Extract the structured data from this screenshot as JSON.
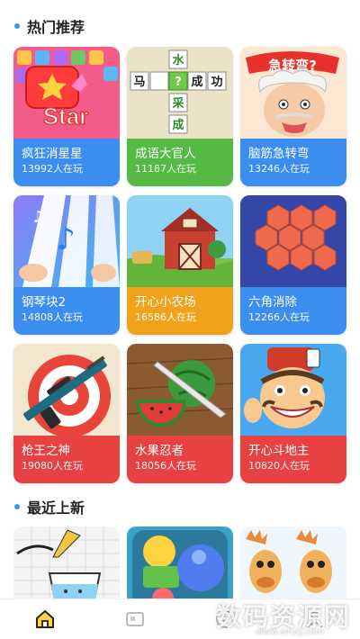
{
  "hot": {
    "title": "热门推荐",
    "games": [
      {
        "name": "疯狂消星星",
        "players": "13992人在玩",
        "color": "#3b8ef0"
      },
      {
        "name": "成语大官人",
        "players": "11187人在玩",
        "color": "#55b944"
      },
      {
        "name": "脑筋急转弯",
        "players": "13246人在玩",
        "color": "#3b8ef0"
      },
      {
        "name": "钢琴块2",
        "players": "14808人在玩",
        "color": "#3b8ef0"
      },
      {
        "name": "开心小农场",
        "players": "16586人在玩",
        "color": "#f2a21a"
      },
      {
        "name": "六角消除",
        "players": "12266人在玩",
        "color": "#3b8ef0"
      },
      {
        "name": "枪王之神",
        "players": "19080人在玩",
        "color": "#e84141"
      },
      {
        "name": "水果忍者",
        "players": "18056人在玩",
        "color": "#e84141"
      },
      {
        "name": "开心斗地主",
        "players": "10820人在玩",
        "color": "#e84141"
      }
    ]
  },
  "art": {
    "star_text": "Star",
    "idiom_chars": [
      "马",
      "水",
      "?",
      "成",
      "功",
      "采",
      "成"
    ],
    "brain_text": "急转弯?"
  },
  "recent": {
    "title": "最近上新"
  },
  "tabbar": {
    "tabs": [
      "home-icon",
      "games-icon",
      "rank-icon",
      "profile-icon"
    ],
    "active": 0
  },
  "watermark": {
    "brand": "数码资源网",
    "url": "www.smzy.com"
  }
}
